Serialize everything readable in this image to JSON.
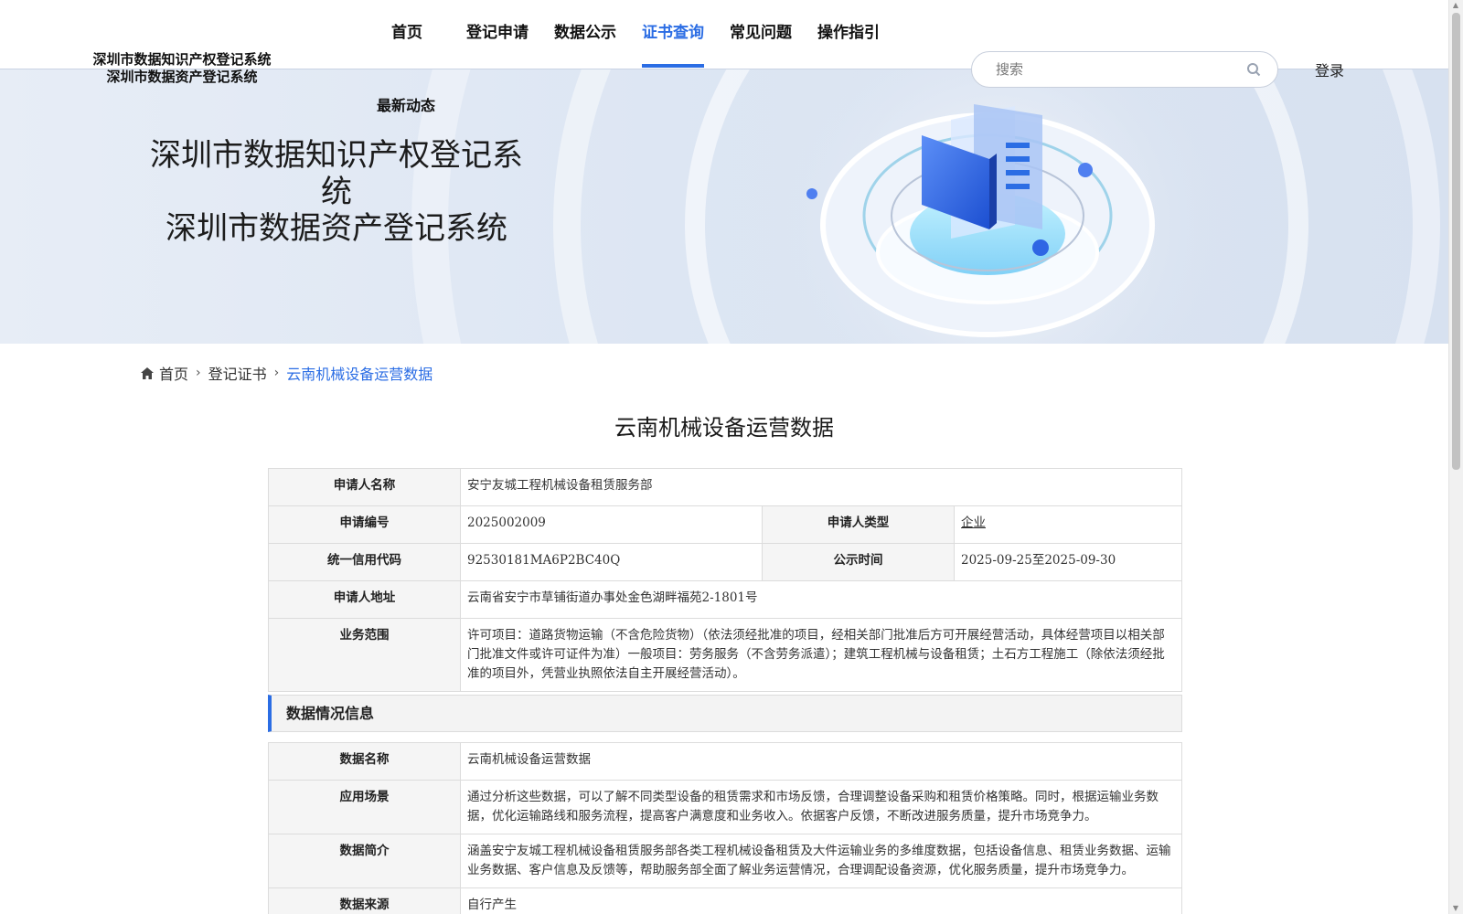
{
  "header": {
    "logo_line1": "深圳市数据知识产权登记系统",
    "logo_line2": "深圳市数据资产登记系统",
    "nav": [
      {
        "label": "首页"
      },
      {
        "label": "登记申请"
      },
      {
        "label": "数据公示"
      },
      {
        "label": "证书查询",
        "active": true
      },
      {
        "label": "常见问题"
      },
      {
        "label": "操作指引"
      }
    ],
    "more_nav_label": "最新动态",
    "search_placeholder": "搜索",
    "login_label": "登录"
  },
  "banner": {
    "title_line1": "深圳市数据知识产权登记系统",
    "title_line2": "深圳市数据资产登记系统"
  },
  "breadcrumb": {
    "home_icon": "home-icon",
    "home": "首页",
    "level2": "登记证书",
    "current": "云南机械设备运营数据"
  },
  "page_title": "云南机械设备运营数据",
  "applicant": {
    "name_label": "申请人名称",
    "name": "安宁友城工程机械设备租赁服务部",
    "app_no_label": "申请编号",
    "app_no": "2025002009",
    "type_label": "申请人类型",
    "type": "企业",
    "credit_code_label": "统一信用代码",
    "credit_code": "92530181MA6P2BC40Q",
    "publicity_label": "公示时间",
    "publicity": "2025-09-25至2025-09-30",
    "address_label": "申请人地址",
    "address": "云南省安宁市草铺街道办事处金色湖畔福苑2-1801号",
    "scope_label": "业务范围",
    "scope": "许可项目：道路货物运输（不含危险货物）（依法须经批准的项目，经相关部门批准后方可开展经营活动，具体经营项目以相关部门批准文件或许可证件为准）一般项目：劳务服务（不含劳务派遣）；建筑工程机械与设备租赁；土石方工程施工（除依法须经批准的项目外，凭营业执照依法自主开展经营活动）。"
  },
  "data_section": {
    "title": "数据情况信息",
    "name_label": "数据名称",
    "name": "云南机械设备运营数据",
    "scenario_label": "应用场景",
    "scenario": "通过分析这些数据，可以了解不同类型设备的租赁需求和市场反馈，合理调整设备采购和租赁价格策略。同时，根据运输业务数据，优化运输路线和服务流程，提高客户满意度和业务收入。依据客户反馈，不断改进服务质量，提升市场竞争力。",
    "intro_label": "数据简介",
    "intro": "涵盖安宁友城工程机械设备租赁服务部各类工程机械设备租赁及大件运输业务的多维度数据，包括设备信息、租赁业务数据、运输业务数据、客户信息及反馈等，帮助服务部全面了解业务运营情况，合理调配设备资源，优化服务质量，提升市场竞争力。",
    "source_label": "数据来源",
    "source": "自行产生"
  },
  "colors": {
    "accent": "#2b6de4",
    "label_bg": "#f5f5f5"
  }
}
